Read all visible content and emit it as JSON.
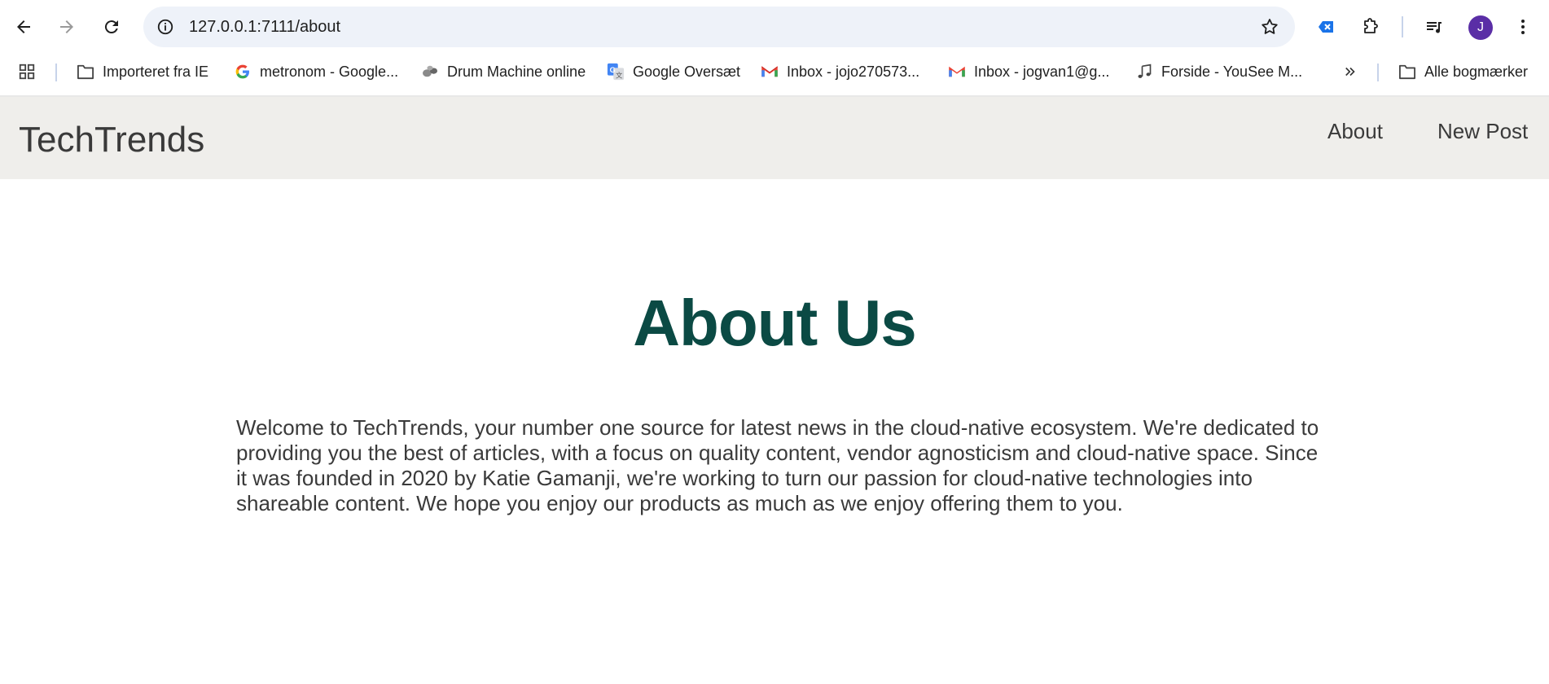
{
  "browser": {
    "url": "127.0.0.1:7111/about",
    "avatar_initial": "J",
    "bookmarks": [
      {
        "label": "Importeret fra IE",
        "icon": "folder-icon"
      },
      {
        "label": "metronom - Google...",
        "icon": "google-icon"
      },
      {
        "label": "Drum Machine online",
        "icon": "drum-machine-icon"
      },
      {
        "label": "Google Oversæt",
        "icon": "google-translate-icon"
      },
      {
        "label": "Inbox - jojo270573...",
        "icon": "gmail-icon"
      },
      {
        "label": "Inbox - jogvan1@g...",
        "icon": "gmail-icon"
      },
      {
        "label": "Forside - YouSee M...",
        "icon": "music-note-icon"
      }
    ],
    "all_bookmarks_label": "Alle bogmærker"
  },
  "navbar": {
    "brand": "TechTrends",
    "links": [
      "About",
      "New Post"
    ]
  },
  "main": {
    "title": "About Us",
    "paragraph": "Welcome to TechTrends, your number one source for latest news in the cloud-native ecosystem. We're dedicated to providing you the best of articles, with a focus on quality content, vendor agnosticism and cloud-native space. Since it was founded in 2020 by Katie Gamanji, we're working to turn our passion for cloud-native technologies into shareable content. We hope you enjoy our products as much as we enjoy offering them to you."
  },
  "colors": {
    "heading": "#0b4a44",
    "navbar_bg": "#efeeeb",
    "omnibox_bg": "#eef2f9",
    "avatar_bg": "#5a2ea6"
  }
}
